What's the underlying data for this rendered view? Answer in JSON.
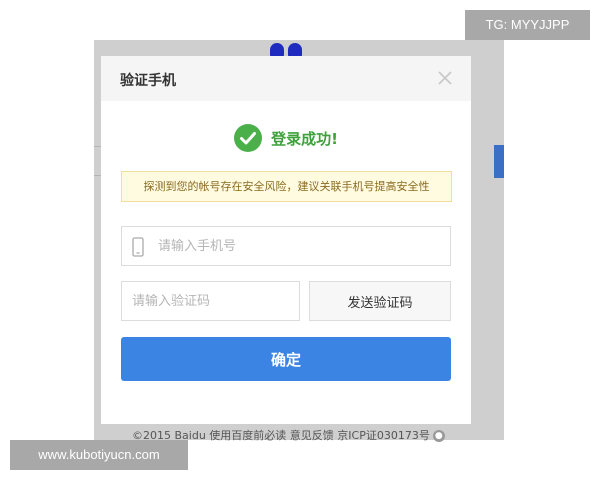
{
  "dialog": {
    "title": "验证手机",
    "success_text": "登录成功!",
    "notice": "探测到您的帐号存在安全风险，建议关联手机号提高安全性",
    "phone_placeholder": "请输入手机号",
    "code_placeholder": "请输入验证码",
    "send_code_label": "发送验证码",
    "confirm_label": "确定"
  },
  "background": {
    "footer_text": "©2015 Baidu 使用百度前必读 意见反馈 京ICP证030173号"
  },
  "watermarks": {
    "top": "TG: MYYJJPP",
    "bottom": "www.kubotiyucn.com"
  },
  "icons": {
    "close": "close-icon",
    "success": "check-circle-icon",
    "phone": "mobile-phone-icon"
  },
  "colors": {
    "success_green": "#3ea13c",
    "primary_blue": "#3c84e3",
    "notice_bg": "#fffbe0",
    "notice_border": "#f0dea0"
  }
}
